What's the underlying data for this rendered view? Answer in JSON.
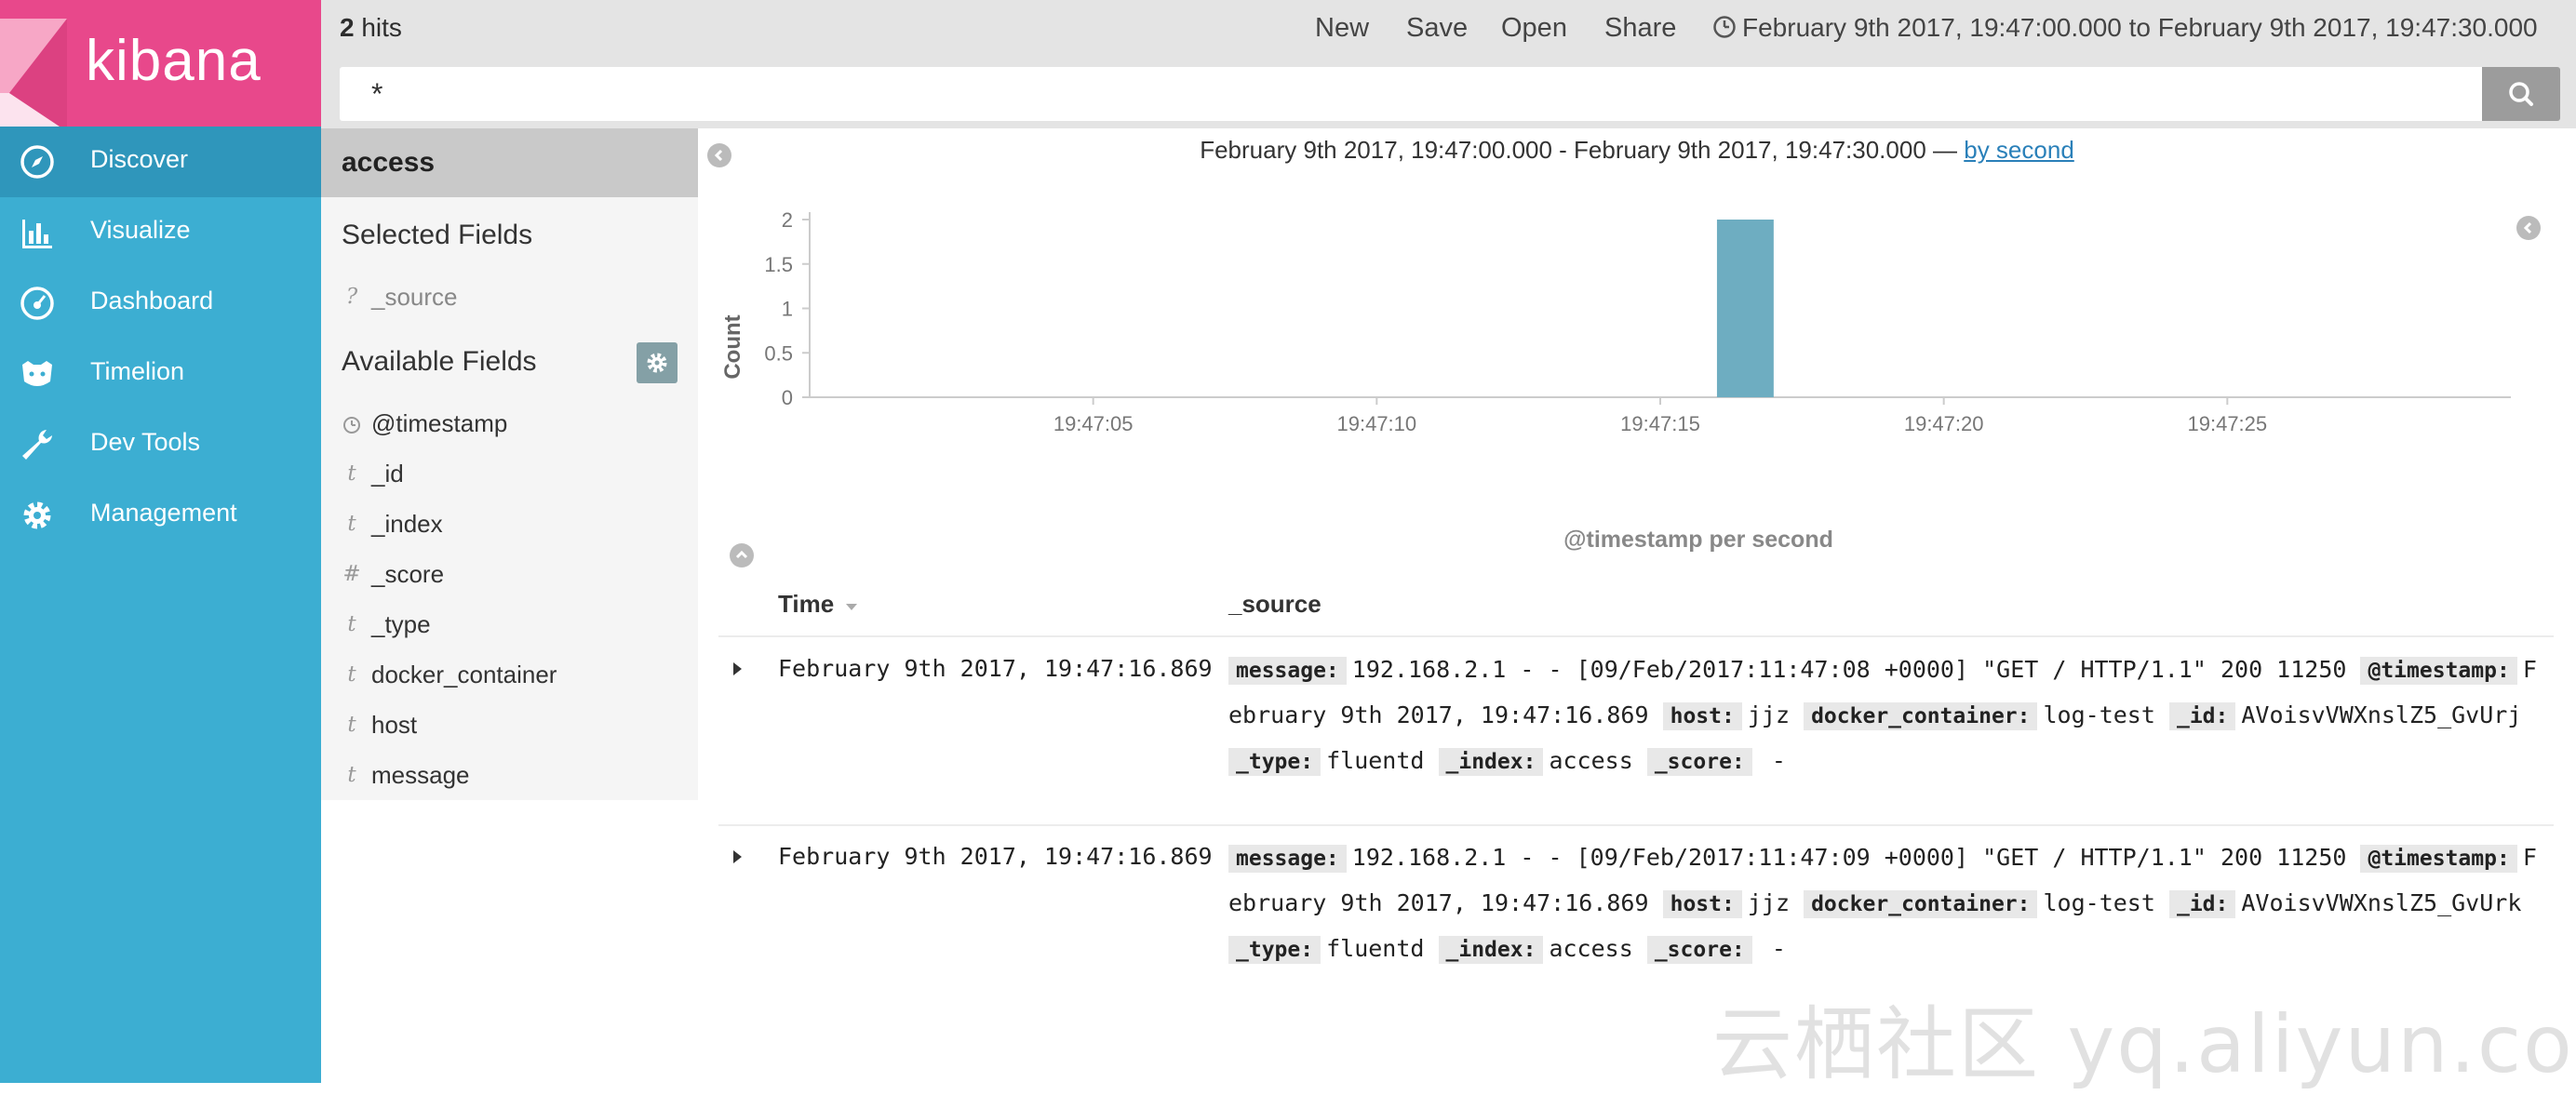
{
  "brand": {
    "name": "kibana",
    "color": "#e8488b"
  },
  "nav": {
    "items": [
      {
        "label": "Discover",
        "icon": "compass-icon"
      },
      {
        "label": "Visualize",
        "icon": "bar-chart-icon"
      },
      {
        "label": "Dashboard",
        "icon": "dashboard-icon"
      },
      {
        "label": "Timelion",
        "icon": "timelion-icon"
      },
      {
        "label": "Dev Tools",
        "icon": "wrench-icon"
      },
      {
        "label": "Management",
        "icon": "gear-icon"
      }
    ],
    "active": "Discover"
  },
  "topbar": {
    "hits_count": "2",
    "hits_label": "hits",
    "menu": [
      "New",
      "Save",
      "Open",
      "Share"
    ],
    "time_range": "February 9th 2017, 19:47:00.000 to February 9th 2017, 19:47:30.000"
  },
  "search": {
    "value": "*"
  },
  "sidebar": {
    "index": "access",
    "selected_title": "Selected Fields",
    "selected_fields": [
      {
        "type": "?",
        "name": "_source"
      }
    ],
    "available_title": "Available Fields",
    "available_fields": [
      {
        "type": "clock",
        "name": "@timestamp"
      },
      {
        "type": "t",
        "name": "_id"
      },
      {
        "type": "t",
        "name": "_index"
      },
      {
        "type": "#",
        "name": "_score"
      },
      {
        "type": "t",
        "name": "_type"
      },
      {
        "type": "t",
        "name": "docker_container"
      },
      {
        "type": "t",
        "name": "host"
      },
      {
        "type": "t",
        "name": "message"
      }
    ]
  },
  "histogram": {
    "range_text": "February 9th 2017, 19:47:00.000 - February 9th 2017, 19:47:30.000 —",
    "interval_link": "by second"
  },
  "chart_data": {
    "type": "bar",
    "x": [
      "19:47:16"
    ],
    "values": [
      2
    ],
    "xticks": [
      "19:47:05",
      "19:47:10",
      "19:47:15",
      "19:47:20",
      "19:47:25"
    ],
    "yticks": [
      "0",
      "0.5",
      "1",
      "1.5",
      "2"
    ],
    "xlabel": "@timestamp per second",
    "ylabel": "Count",
    "ylim": [
      0,
      2
    ],
    "xrange_seconds": [
      0,
      30
    ],
    "bar_color": "#6eadc1"
  },
  "table": {
    "col_time": "Time",
    "col_source": "_source",
    "rows": [
      {
        "time": "February 9th 2017, 19:47:16.869",
        "fields": [
          {
            "k": "message:",
            "v": "192.168.2.1 - - [09/Feb/2017:11:47:08 +0000] \"GET / HTTP/1.1\" 200 11250"
          },
          {
            "k": "@timestamp:",
            "v": "February 9th 2017, 19:47:16.869"
          },
          {
            "k": "host:",
            "v": "jjz"
          },
          {
            "k": "docker_container:",
            "v": "log-test"
          },
          {
            "k": "_id:",
            "v": "AVoisvVWXnslZ5_GvUrj"
          },
          {
            "k": "_type:",
            "v": "fluentd"
          },
          {
            "k": "_index:",
            "v": "access"
          },
          {
            "k": "_score:",
            "v": " - "
          }
        ]
      },
      {
        "time": "February 9th 2017, 19:47:16.869",
        "fields": [
          {
            "k": "message:",
            "v": "192.168.2.1 - - [09/Feb/2017:11:47:09 +0000] \"GET / HTTP/1.1\" 200 11250"
          },
          {
            "k": "@timestamp:",
            "v": "February 9th 2017, 19:47:16.869"
          },
          {
            "k": "host:",
            "v": "jjz"
          },
          {
            "k": "docker_container:",
            "v": "log-test"
          },
          {
            "k": "_id:",
            "v": "AVoisvVWXnslZ5_GvUrk"
          },
          {
            "k": "_type:",
            "v": "fluentd"
          },
          {
            "k": "_index:",
            "v": "access"
          },
          {
            "k": "_score:",
            "v": " - "
          }
        ]
      }
    ]
  },
  "watermark": "云栖社区 yq.aliyun.com"
}
